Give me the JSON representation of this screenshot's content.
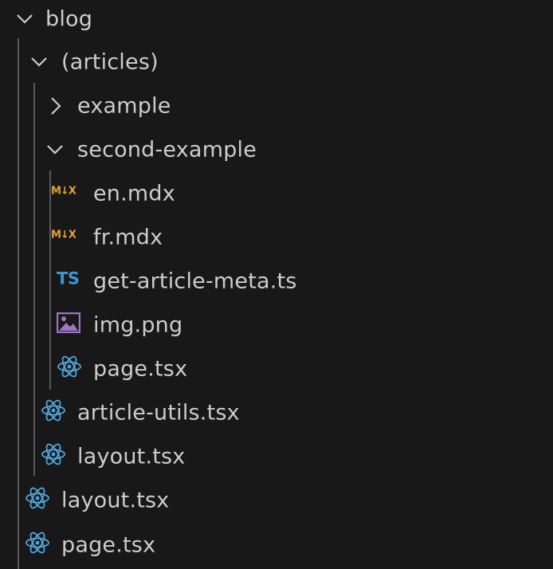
{
  "explorer": {
    "items": [
      {
        "label": "blog",
        "kind": "folder",
        "expanded": true,
        "icon": "chevron-down-icon"
      },
      {
        "label": "(articles)",
        "kind": "folder",
        "expanded": true,
        "icon": "chevron-down-icon"
      },
      {
        "label": "example",
        "kind": "folder",
        "expanded": false,
        "icon": "chevron-right-icon"
      },
      {
        "label": "second-example",
        "kind": "folder",
        "expanded": true,
        "icon": "chevron-down-icon"
      },
      {
        "label": "en.mdx",
        "kind": "file",
        "icon": "mdx-file-icon"
      },
      {
        "label": "fr.mdx",
        "kind": "file",
        "icon": "mdx-file-icon"
      },
      {
        "label": "get-article-meta.ts",
        "kind": "file",
        "icon": "typescript-file-icon"
      },
      {
        "label": "img.png",
        "kind": "file",
        "icon": "image-file-icon"
      },
      {
        "label": "page.tsx",
        "kind": "file",
        "icon": "react-file-icon"
      },
      {
        "label": "article-utils.tsx",
        "kind": "file",
        "icon": "react-file-icon"
      },
      {
        "label": "layout.tsx",
        "kind": "file",
        "icon": "react-file-icon"
      },
      {
        "label": "layout.tsx",
        "kind": "file",
        "icon": "react-file-icon"
      },
      {
        "label": "page.tsx",
        "kind": "file",
        "icon": "react-file-icon"
      }
    ]
  },
  "icon_glyphs": {
    "mdx": "M↓X",
    "ts": "TS"
  },
  "colors": {
    "background": "#181818",
    "text": "#cccccc",
    "indent_guide": "#585858",
    "mdx_icon": "#e2a13b",
    "typescript_icon": "#3c96d6",
    "react_icon": "#52a5d9",
    "image_icon": "#a074c4"
  }
}
